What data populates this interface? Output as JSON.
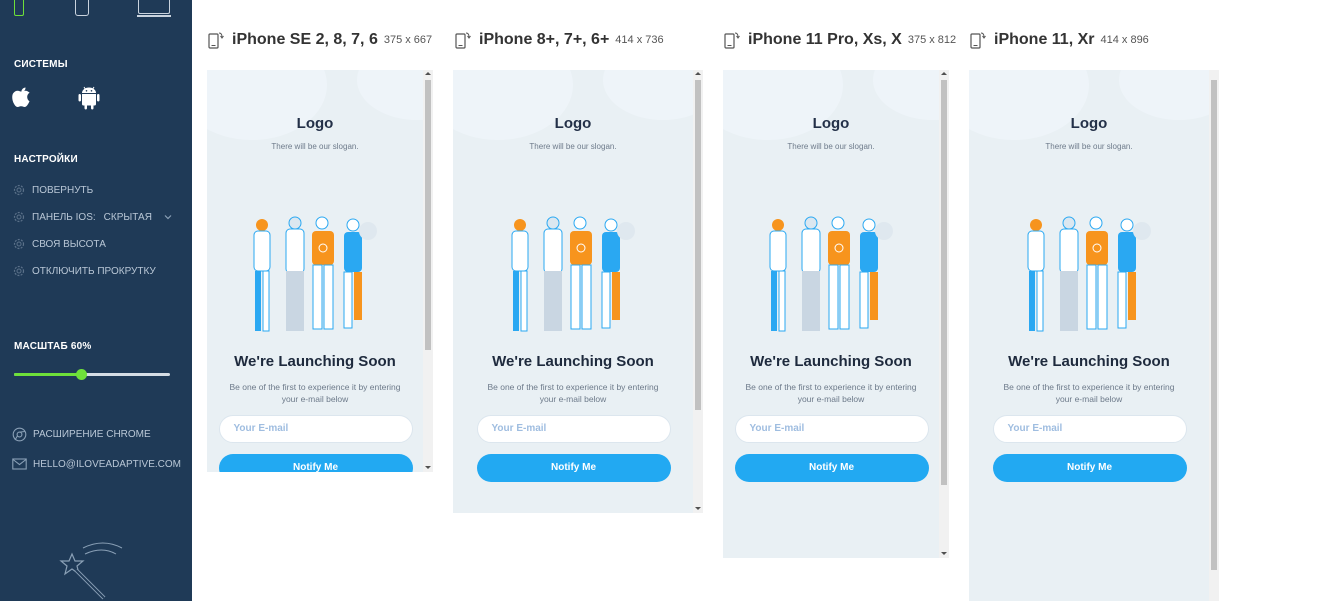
{
  "sidebar": {
    "device_tabs": [
      "phone-small-icon",
      "phone-icon",
      "monitor-icon"
    ],
    "systems_title": "СИСТЕМЫ",
    "os_icons": [
      "apple-icon",
      "android-icon"
    ],
    "settings_title": "НАСТРОЙКИ",
    "settings": {
      "rotate": "ПОВЕРНУТЬ",
      "ios_panel": "ПАНЕЛЬ IOS:",
      "ios_panel_value": "СКРЫТАЯ",
      "custom_height": "СВОЯ ВЫСОТА",
      "disable_scroll": "ОТКЛЮЧИТЬ ПРОКРУТКУ"
    },
    "scale_label": "МАСШТАБ 60%",
    "scale_fraction": 0.43,
    "chrome_extension": "РАСШИРЕНИЕ CHROME",
    "email_link": "HELLO@ILOVEADAPTIVE.COM"
  },
  "colors": {
    "sidebar_bg": "#1f3a57",
    "accent_green": "#6ee03a",
    "button_blue": "#22a9f2",
    "preview_bg": "#e9f0f4"
  },
  "devices": [
    {
      "name": "iPhone SE 2, 8, 7, 6",
      "resolution": "375 x 667"
    },
    {
      "name": "iPhone 8+, 7+, 6+",
      "resolution": "414 x 736"
    },
    {
      "name": "iPhone 11 Pro, Xs, X",
      "resolution": "375 x 812"
    },
    {
      "name": "iPhone 11, Xr",
      "resolution": "414 x 896"
    }
  ],
  "preview": {
    "logo": "Logo",
    "slogan": "There will be our slogan.",
    "headline": "We're Launching Soon",
    "description": "Be one of the first to experience it by entering your e-mail below",
    "email_placeholder": "Your E-mail",
    "notify_button": "Notify Me"
  }
}
